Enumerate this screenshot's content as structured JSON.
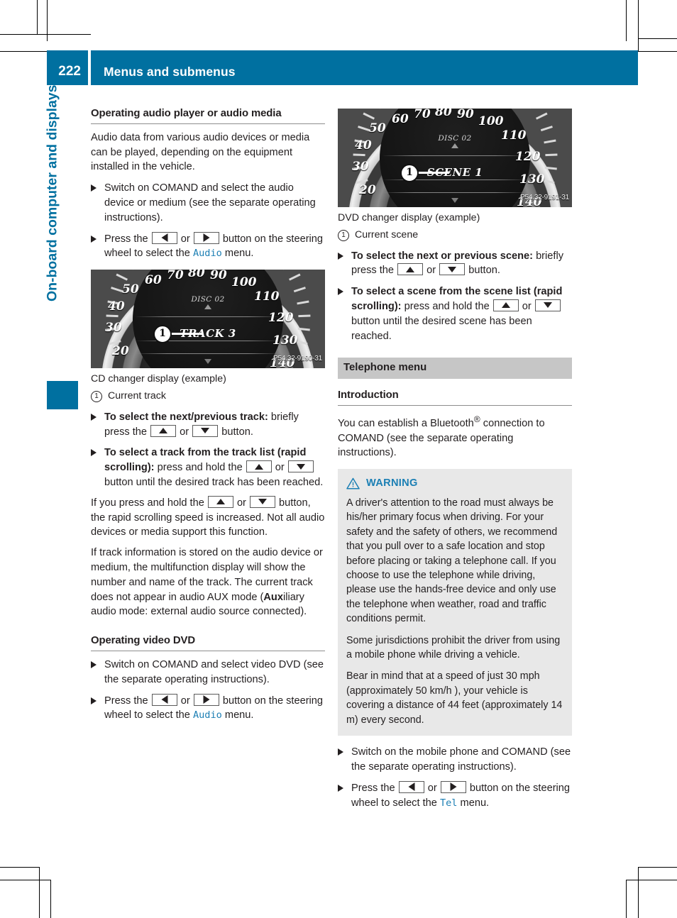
{
  "header": {
    "page_number": "222",
    "title": "Menus and submenus"
  },
  "chapter": {
    "vertical_title": "On-board computer and displays"
  },
  "left_column": {
    "section1_heading": "Operating audio player or audio media",
    "section1_paragraph": "Audio data from various audio devices or media can be played, depending on the equipment installed in the vehicle.",
    "step1": "Switch on COMAND and select the audio device or medium (see the separate operating instructions).",
    "step2_pre": "Press the ",
    "step2_mid": " or ",
    "step2_post": " button on the steering wheel to select the ",
    "step2_menu": "Audio",
    "step2_end": " menu.",
    "figure1": {
      "disc_label": "DISC 02",
      "track_label": "TRACK 3",
      "callout_number": "1",
      "code": "P54.32-9190-31",
      "scale_numbers": [
        "20",
        "30",
        "40",
        "50",
        "60",
        "70",
        "80",
        "90",
        "100",
        "110",
        "120",
        "130",
        "140"
      ]
    },
    "figure1_caption": "CD changer display (example)",
    "figure1_legend_num": "1",
    "figure1_legend_text": "Current track",
    "step3_bold": "To select the next/previous track:",
    "step3_pre": " briefly press the ",
    "step3_mid": " or ",
    "step3_post": " button.",
    "step4_bold": "To select a track from the track list (rapid scrolling):",
    "step4_pre": " press and hold the ",
    "step4_mid": " or ",
    "step4_post": " button until the desired track has been reached.",
    "para2_pre": "If you press and hold the ",
    "para2_mid": " or ",
    "para2_post": " button, the rapid scrolling speed is increased. Not all audio devices or media support this function.",
    "para3_a": "If track information is stored on the audio device or medium, the multifunction display will show the number and name of the track. The current track does not appear in audio AUX mode (",
    "para3_bold": "Aux",
    "para3_b": "iliary audio mode: external audio source connected).",
    "section2_heading": "Operating video DVD",
    "step5": "Switch on COMAND and select video DVD (see the separate operating instructions).",
    "step6_pre": "Press the ",
    "step6_mid": " or ",
    "step6_post": " button on the steering wheel to select the ",
    "step6_menu": "Audio",
    "step6_end": " menu."
  },
  "right_column": {
    "figure2": {
      "disc_label": "DISC 02",
      "track_label": "SCENE 1",
      "callout_number": "1",
      "code": "P54.32-9191-31",
      "scale_numbers": [
        "20",
        "30",
        "40",
        "50",
        "60",
        "70",
        "80",
        "90",
        "100",
        "110",
        "120",
        "130",
        "140"
      ]
    },
    "figure2_caption": "DVD changer display (example)",
    "figure2_legend_num": "1",
    "figure2_legend_text": "Current scene",
    "step1_bold": "To select the next or previous scene:",
    "step1_pre": " briefly press the ",
    "step1_mid": " or ",
    "step1_post": " button.",
    "step2_bold": "To select a scene from the scene list (rapid scrolling):",
    "step2_pre": " press and hold the ",
    "step2_mid": " or ",
    "step2_post": " button until the desired scene has been reached.",
    "banner_title": "Telephone menu",
    "intro_heading": "Introduction",
    "intro_paragraph_a": "You can establish a Bluetooth",
    "intro_paragraph_sup": "®",
    "intro_paragraph_b": " connection to COMAND (see the separate operating instructions).",
    "warning": {
      "label": "WARNING",
      "paragraph1": "A driver's attention to the road must always be his/her primary focus when driving. For your safety and the safety of others, we recommend that you pull over to a safe location and stop before placing or taking a telephone call. If you choose to use the telephone while driving, please use the hands-free device and only use the telephone when weather, road and traffic conditions permit.",
      "paragraph2": "Some jurisdictions prohibit the driver from using a mobile phone while driving a vehicle.",
      "paragraph3": "Bear in mind that at a speed of just 30 mph (approximately 50 km/h ), your vehicle is covering a distance of 44 feet (approximately 14 m) every second."
    },
    "step3": "Switch on the mobile phone and COMAND (see the separate operating instructions).",
    "step4_pre": "Press the ",
    "step4_mid": " or ",
    "step4_post": " button on the steering wheel to select the ",
    "step4_menu": "Tel",
    "step4_end": " menu."
  },
  "colors": {
    "accent_blue": "#0070a0",
    "link_blue": "#1d7fb4",
    "banner_gray": "#c6c6c6",
    "warning_bg": "#e8e8e8"
  }
}
